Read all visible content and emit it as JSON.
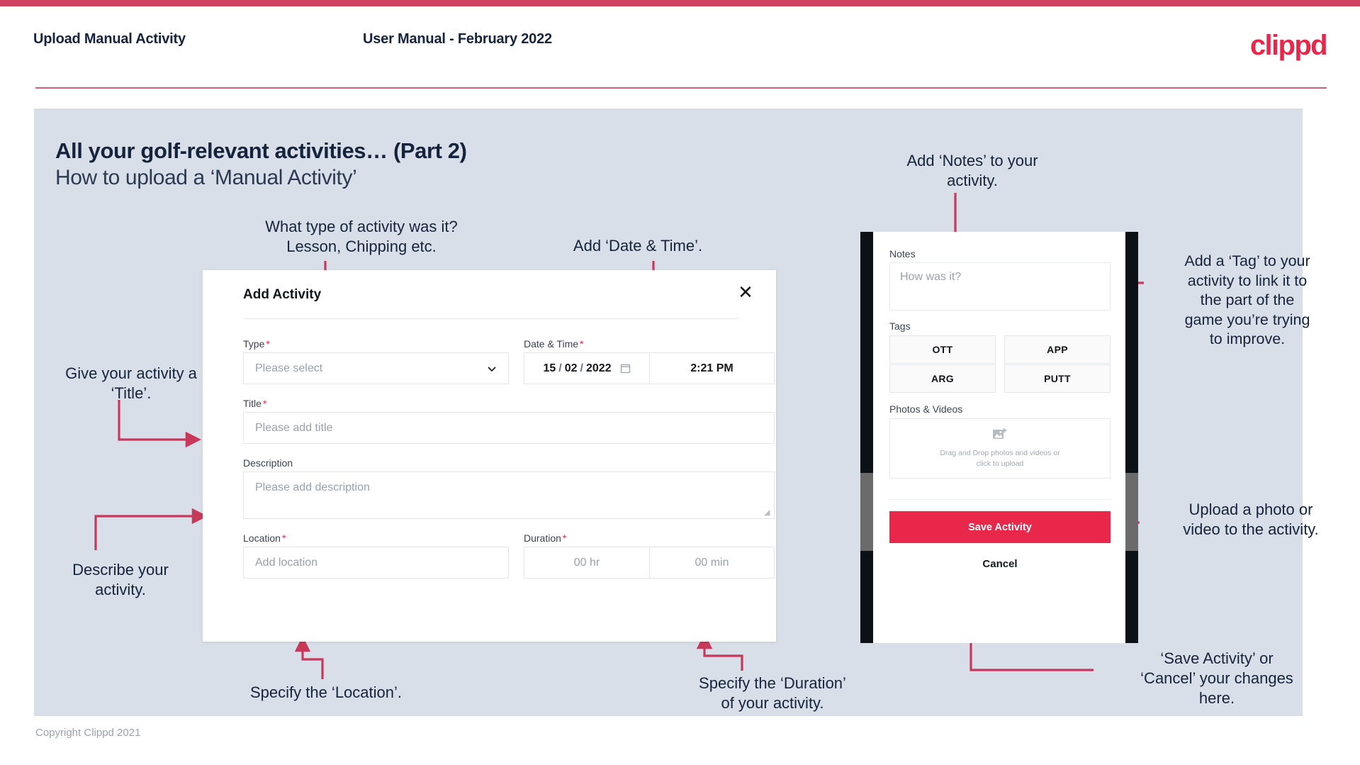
{
  "header": {
    "title": "Upload Manual Activity",
    "subtitle": "User Manual - February 2022",
    "brand": "clippd"
  },
  "slide": {
    "title": "All your golf-relevant activities… (Part 2)",
    "subtitle": "How to upload a ‘Manual Activity’"
  },
  "footer": {
    "copyright": "Copyright Clippd 2021"
  },
  "colors": {
    "accent_pink": "#e8274b",
    "accent_bar": "#cf4360",
    "panel_bg": "#d9dfe8",
    "text_dark": "#16233c",
    "arrow": "#c8385a"
  },
  "modal": {
    "title": "Add Activity",
    "close_icon": "close-icon",
    "fields": {
      "type": {
        "label": "Type",
        "required": "*",
        "placeholder": "Please select",
        "chevron_icon": "chevron-down-icon"
      },
      "datetime": {
        "label": "Date & Time",
        "required": "*",
        "day": "15",
        "sep1": "/",
        "month": "02",
        "sep2": "/",
        "year": "2022",
        "calendar_icon": "calendar-icon",
        "time": "2:21 PM"
      },
      "title": {
        "label": "Title",
        "required": "*",
        "placeholder": "Please add title"
      },
      "description": {
        "label": "Description",
        "required": "",
        "placeholder": "Please add description"
      },
      "location": {
        "label": "Location",
        "required": "*",
        "placeholder": "Add location"
      },
      "duration": {
        "label": "Duration",
        "required": "*",
        "hours_placeholder": "00 hr",
        "minutes_placeholder": "00 min"
      }
    }
  },
  "phone": {
    "notes": {
      "label": "Notes",
      "placeholder": "How was it?"
    },
    "tags": {
      "label": "Tags",
      "items": [
        "OTT",
        "APP",
        "ARG",
        "PUTT"
      ]
    },
    "photos": {
      "label": "Photos & Videos",
      "icon": "add-image-icon",
      "line1": "Drag and Drop photos and videos or",
      "line2": "click to upload"
    },
    "save_label": "Save Activity",
    "cancel_label": "Cancel"
  },
  "annotations": {
    "type": "What type of activity was it?\nLesson, Chipping etc.",
    "datetime": "Add ‘Date & Time’.",
    "title": "Give your activity a\n‘Title’.",
    "description": "Describe your\nactivity.",
    "location": "Specify the ‘Location’.",
    "duration": "Specify the ‘Duration’\nof your activity.",
    "notes": "Add ‘Notes’ to your\nactivity.",
    "tags": "Add a ‘Tag’ to your\nactivity to link it to\nthe part of the\ngame you’re trying\nto improve.",
    "upload": "Upload a photo or\nvideo to the activity.",
    "save": "‘Save Activity’ or\n‘Cancel’ your changes\nhere."
  }
}
